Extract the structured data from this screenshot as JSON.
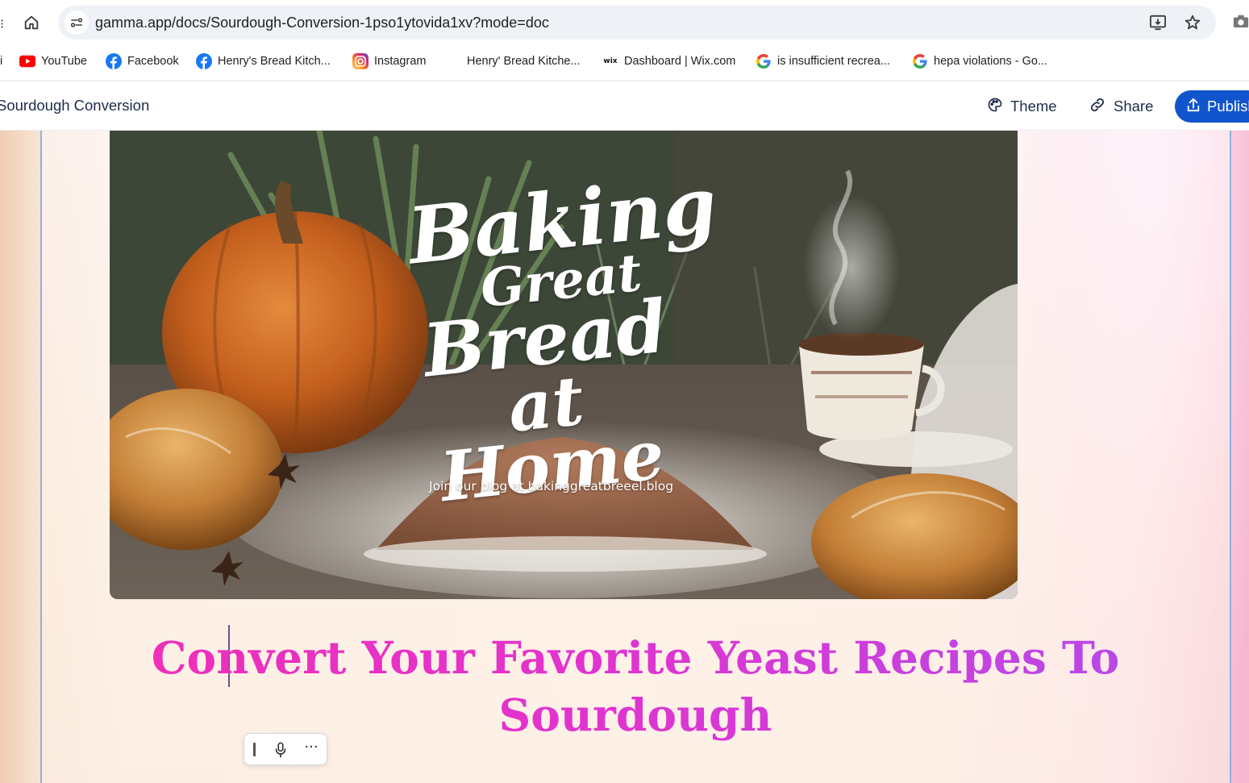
{
  "browser": {
    "url": "gamma.app/docs/Sourdough-Conversion-1pso1ytovida1xv?mode=doc",
    "edge_glyph": "⁝",
    "bookmarks": [
      {
        "label": "i",
        "icon": "truncated-bookmark"
      },
      {
        "label": "YouTube",
        "icon": "youtube-icon"
      },
      {
        "label": "Facebook",
        "icon": "facebook-icon"
      },
      {
        "label": "Henry's Bread Kitch...",
        "icon": "facebook-icon"
      },
      {
        "label": "Instagram",
        "icon": "instagram-icon"
      },
      {
        "label": "Henry' Bread Kitche...",
        "icon": "blank-icon"
      },
      {
        "label": "Dashboard | Wix.com",
        "icon": "wix-icon",
        "icon_text": "wix"
      },
      {
        "label": "is insufficient recrea...",
        "icon": "google-icon"
      },
      {
        "label": "hepa violations - Go...",
        "icon": "google-icon"
      }
    ]
  },
  "app": {
    "doc_title": "Sourdough Conversion",
    "theme_label": "Theme",
    "share_label": "Share",
    "publish_label": "Publish",
    "accent_color": "#1155cc"
  },
  "hero": {
    "title_lines": [
      "Baking",
      "Great",
      "Bread",
      "at Home"
    ],
    "caption": "Join our blog at bakinggreatbreeel.blog"
  },
  "heading": {
    "line1": "Convert Your Favorite Yeast Recipes To",
    "line2": "Sourdough",
    "gradient": [
      "#ef2fb8",
      "#b54ae8"
    ]
  },
  "mini_toolbar": {
    "more_glyph": "···",
    "icons": [
      "drag-handle-icon",
      "microphone-icon",
      "more-icon"
    ]
  }
}
